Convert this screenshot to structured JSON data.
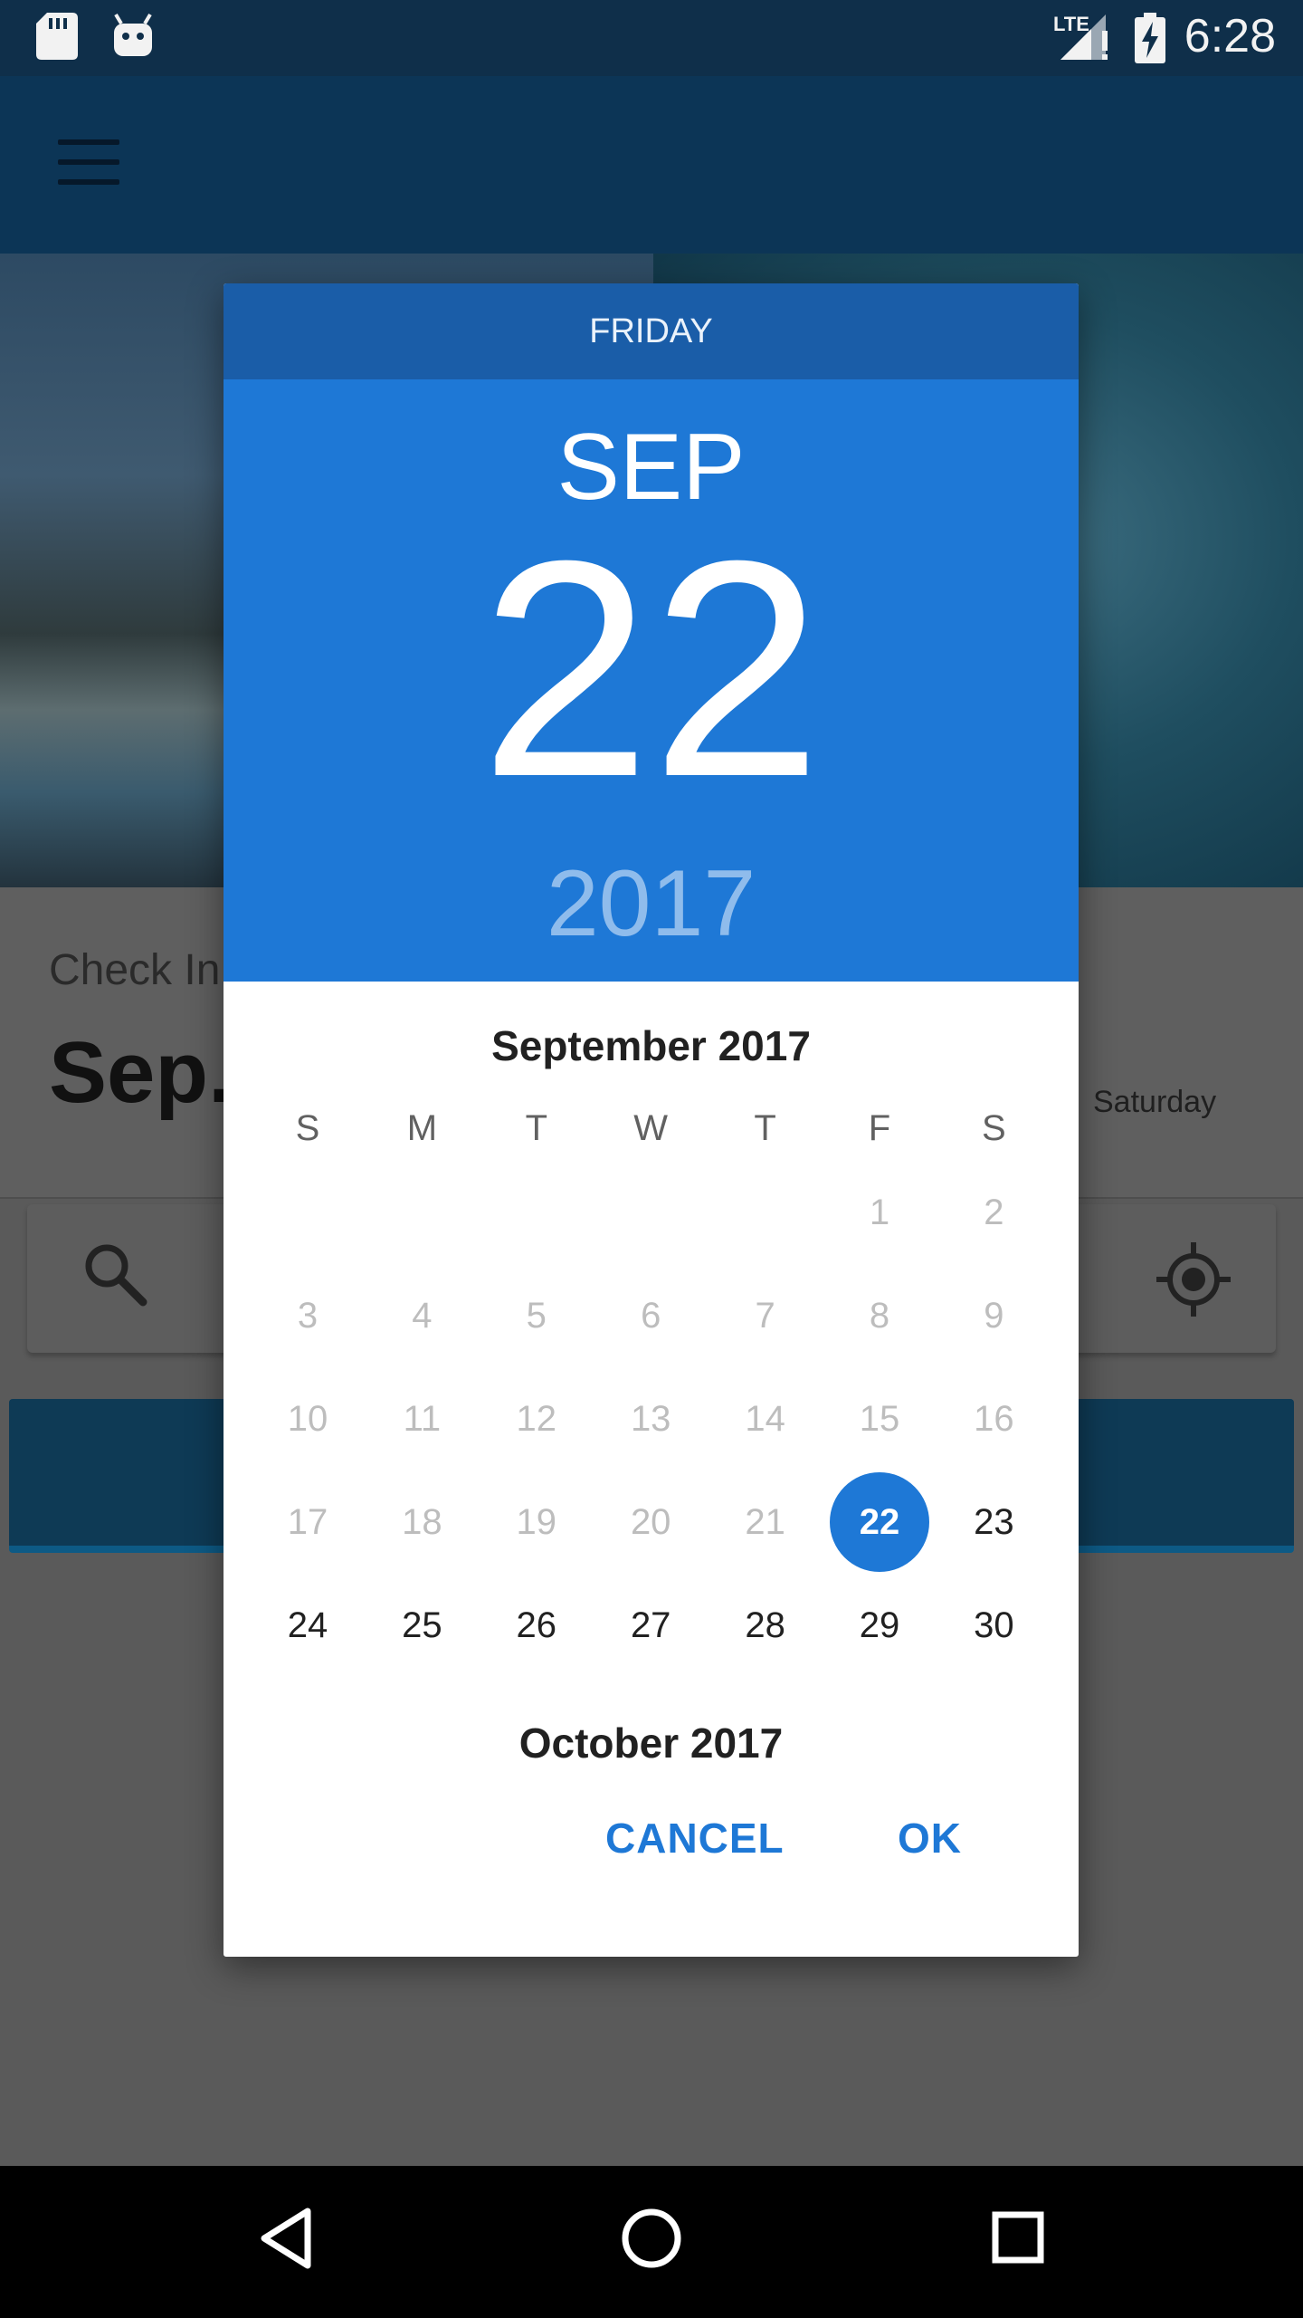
{
  "status_bar": {
    "time": "6:28",
    "network_label": "LTE",
    "icons": [
      "sd-card-icon",
      "android-icon",
      "signal-icon",
      "battery-charging-icon"
    ]
  },
  "app_bar": {
    "menu_icon": "hamburger-menu-icon"
  },
  "background": {
    "checkin_label": "Check In",
    "checkin_date": "Sep.",
    "checkout_day": "Saturday",
    "search_icon": "search-icon",
    "location_icon": "my-location-icon"
  },
  "dialog": {
    "day_of_week": "FRIDAY",
    "month": "SEP",
    "day": "22",
    "year": "2017",
    "month_title": "September 2017",
    "next_month_title": "October 2017",
    "weekdays": [
      "S",
      "M",
      "T",
      "W",
      "T",
      "F",
      "S"
    ],
    "selected_day": 22,
    "days": [
      "1",
      "2",
      "3",
      "4",
      "5",
      "6",
      "7",
      "8",
      "9",
      "10",
      "11",
      "12",
      "13",
      "14",
      "15",
      "16",
      "17",
      "18",
      "19",
      "20",
      "21",
      "22",
      "23",
      "24",
      "25",
      "26",
      "27",
      "28",
      "29",
      "30"
    ],
    "cancel_label": "CANCEL",
    "ok_label": "OK",
    "accent_color": "#1e78d6"
  },
  "nav_bar": {
    "icons": [
      "back-icon",
      "home-icon",
      "recents-icon"
    ]
  }
}
